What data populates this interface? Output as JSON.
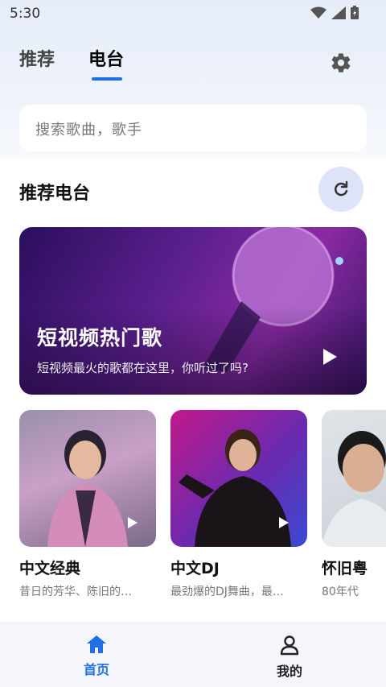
{
  "status_bar": {
    "time": "5:30"
  },
  "tabs": [
    {
      "label": "推荐"
    },
    {
      "label": "电台"
    }
  ],
  "search": {
    "placeholder": "搜索歌曲，歌手"
  },
  "section": {
    "title": "推荐电台"
  },
  "banner": {
    "title": "短视频热门歌",
    "subtitle": "短视频最火的歌都在这里，你听过了吗?"
  },
  "cards": [
    {
      "title": "中文经典",
      "desc": "昔日的芳华、陈旧的…"
    },
    {
      "title": "中文DJ",
      "desc": "最劲爆的DJ舞曲，最…"
    },
    {
      "title": "怀旧粤",
      "desc": "80年代"
    }
  ],
  "bottom_nav": [
    {
      "label": "首页",
      "icon": "home-icon"
    },
    {
      "label": "我的",
      "icon": "user-icon"
    }
  ],
  "colors": {
    "accent": "#1d6fe8",
    "refresh_bg": "#dde3f8"
  }
}
